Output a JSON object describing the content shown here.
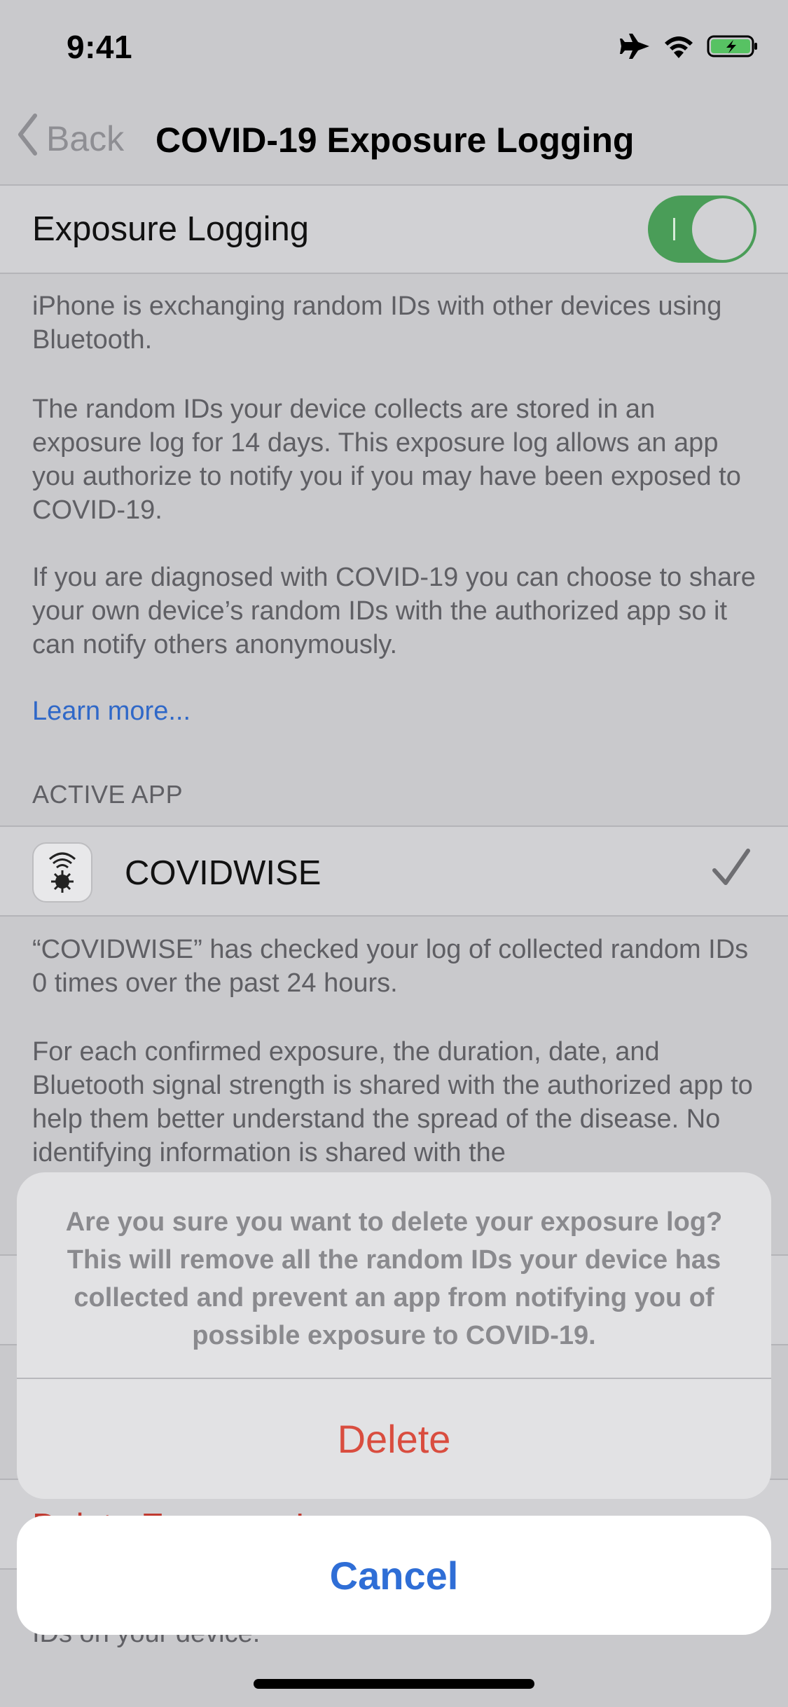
{
  "status_bar": {
    "time": "9:41",
    "icons": [
      "airplane-icon",
      "wifi-icon",
      "battery-charging-icon"
    ]
  },
  "nav": {
    "back_label": "Back",
    "title": "COVID-19 Exposure Logging"
  },
  "exposure_logging": {
    "label": "Exposure Logging",
    "enabled": true
  },
  "descriptions": [
    "iPhone is exchanging random IDs with other devices using Bluetooth.",
    "The random IDs your device collects are stored in an exposure log for 14 days. This exposure log allows an app you authorize to notify you if you may have been exposed to COVID-19.",
    "If you are diagnosed with COVID-19 you can choose to share your own device’s random IDs with the authorized app so it can notify others anonymously."
  ],
  "learn_more": "Learn more...",
  "active_app": {
    "section_header": "ACTIVE APP",
    "name": "COVIDWISE",
    "selected": true,
    "check_info": "“COVIDWISE” has checked your log of collected random IDs 0 times over the past 24 hours.",
    "share_info": "For each confirmed exposure, the duration, date, and Bluetooth signal strength is shared with the authorized app to help them better understand the spread of the disease. No identifying information is shared with the"
  },
  "background": {
    "delete_row_partial": "Delete Exposure Log",
    "footer_partial": "IDs on your device."
  },
  "action_sheet": {
    "message": "Are you sure you want to delete your exposure log? This will remove all the random IDs your device has collected and prevent an app from notifying you of possible exposure to COVID-19.",
    "delete_label": "Delete",
    "cancel_label": "Cancel"
  },
  "colors": {
    "toggle_on": "#4a9d58",
    "link": "#2f68c8",
    "destructive": "#d94d3f",
    "cancel": "#2f6ed6"
  }
}
